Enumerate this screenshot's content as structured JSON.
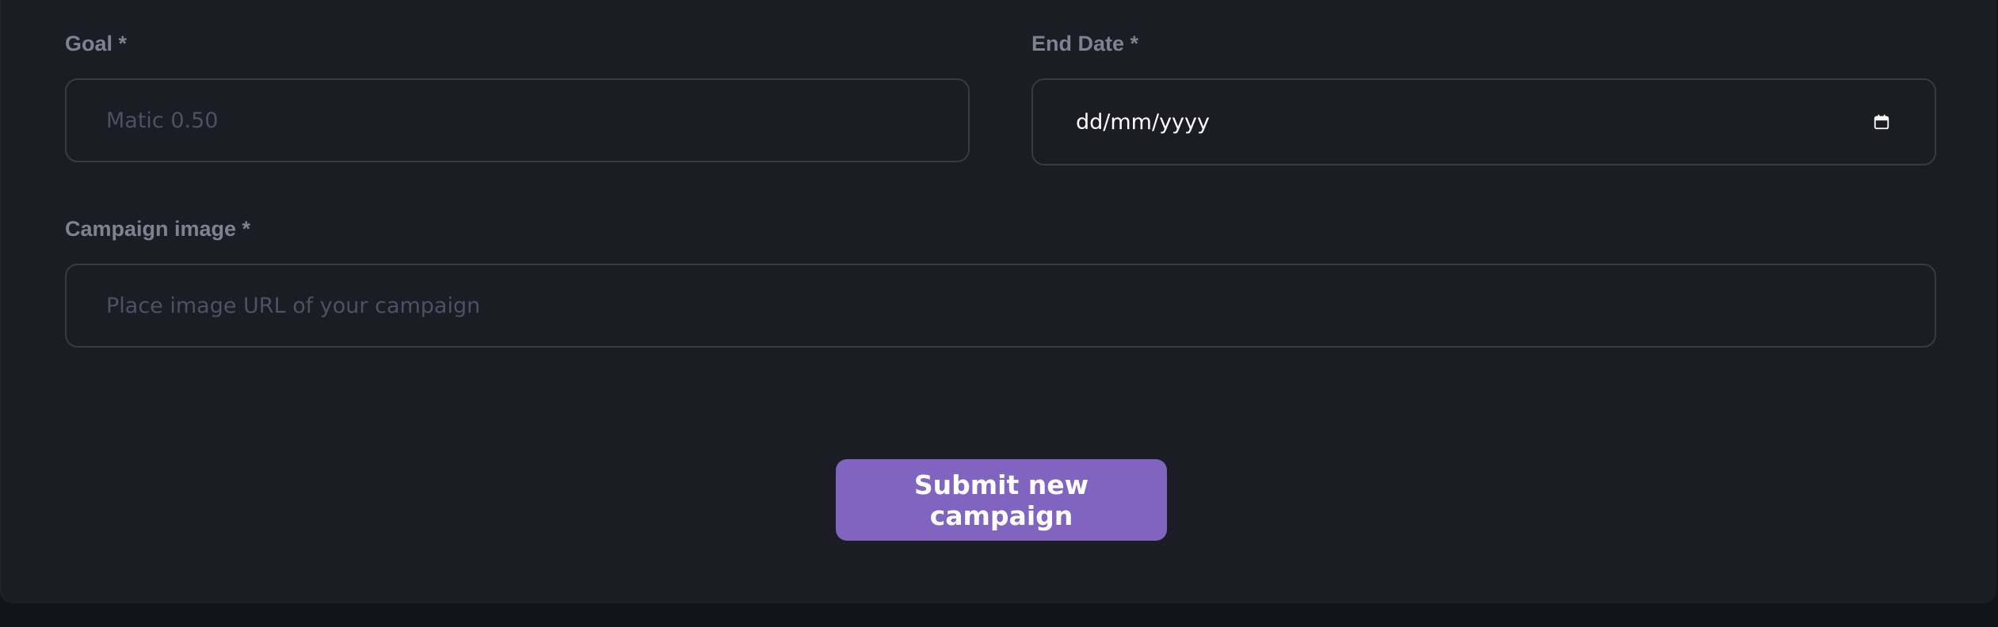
{
  "form": {
    "goal": {
      "label": "Goal *",
      "placeholder": "Matic 0.50"
    },
    "end_date": {
      "label": "End Date *",
      "value": "dd/mm/yyyy",
      "icon": "calendar-icon"
    },
    "campaign_image": {
      "label": "Campaign image *",
      "placeholder": "Place image URL of your campaign"
    },
    "submit_label": "Submit new campaign"
  },
  "colors": {
    "background": "#13131a",
    "card": "#1c1c24",
    "border": "#3a3a43",
    "label": "#808191",
    "placeholder": "#4b5264",
    "button": "#8164c0"
  }
}
